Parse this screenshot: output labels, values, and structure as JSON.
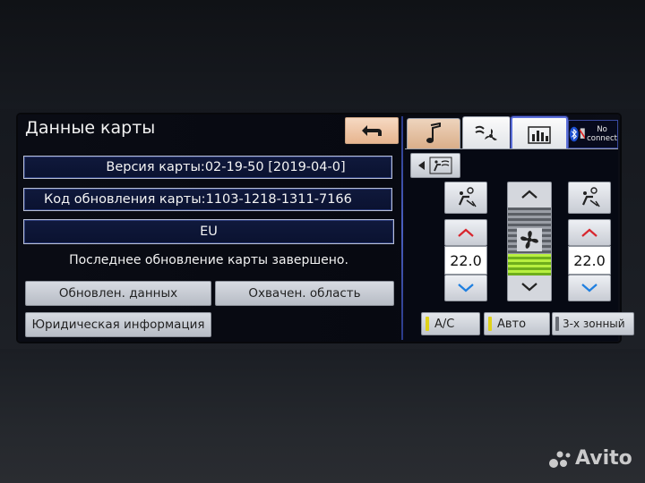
{
  "map": {
    "title": "Данные карты",
    "version": "Версия карты:02-19-50  [2019-04-0]",
    "update_code": "Код обновления карты:1103-1218-1311-7166",
    "region": "EU",
    "status": "Последнее обновление карты завершено.",
    "buttons": {
      "update_data": "Обновлен. данных",
      "coverage": "Охвачен. область",
      "legal": "Юридическая информация"
    }
  },
  "bluetooth": {
    "status_line1": "No",
    "status_line2": "connect"
  },
  "climate": {
    "left_temp": "22.0",
    "right_temp": "22.0",
    "ac_label": "A/C",
    "auto_label": "Авто",
    "zone_label": "3-х зонный",
    "indicator_colors": {
      "ac": "#e0d21a",
      "auto": "#e0d21a",
      "zone": "#6a6e76"
    }
  },
  "icons": {
    "back": "return-arrow-icon",
    "music": "music-note-icon",
    "climate": "climate-fan-icon",
    "info": "bar-chart-icon",
    "bluetooth": "bluetooth-icon",
    "mode": "seat-airflow-icon",
    "fan": "fan-icon"
  },
  "watermark": "Avito"
}
